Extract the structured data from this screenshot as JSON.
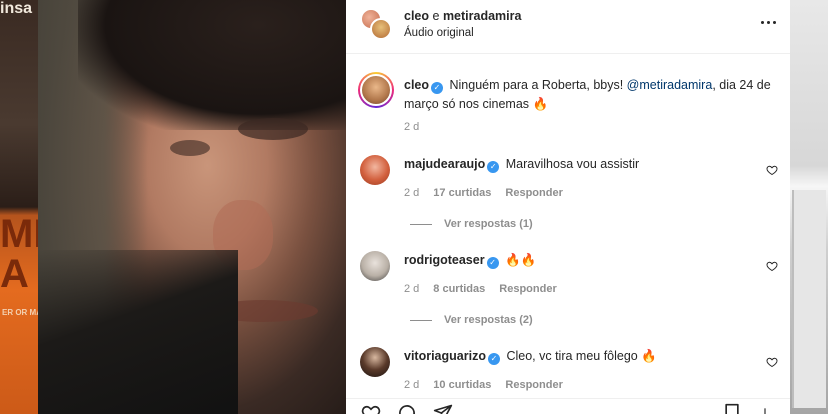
{
  "background": {
    "left_text": "insa",
    "left_big": "ME\nA I",
    "left_small": "ER OR MA"
  },
  "header": {
    "user1": "cleo",
    "connector": "e",
    "user2": "metiradamira",
    "audio": "Áudio original",
    "more_icon": "more-icon"
  },
  "caption": {
    "username": "cleo",
    "text_before": " Ninguém para a Roberta, bbys! ",
    "mention": "@metiradamira",
    "text_after": ", dia 24 de março só nos cinemas 🔥",
    "time": "2 d"
  },
  "comments": [
    {
      "username": "majudearaujo",
      "text": "Maravilhosa vou assistir",
      "time": "2 d",
      "likes": "17 curtidas",
      "reply": "Responder",
      "view_replies": "Ver respostas (1)"
    },
    {
      "username": "rodrigoteaser",
      "text": "🔥🔥",
      "time": "2 d",
      "likes": "8 curtidas",
      "reply": "Responder",
      "view_replies": "Ver respostas (2)"
    },
    {
      "username": "vitoriaguarizo",
      "text": "Cleo, vc tira meu fôlego 🔥",
      "time": "2 d",
      "likes": "10 curtidas",
      "reply": "Responder"
    }
  ],
  "colors": {
    "verified": "#3897f0",
    "mention": "#00376b",
    "meta": "#8e8e8e"
  }
}
